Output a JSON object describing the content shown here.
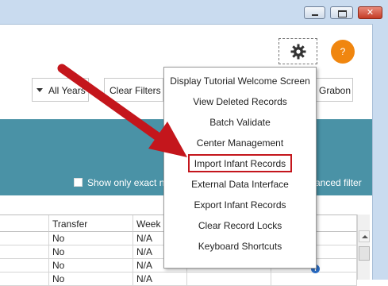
{
  "window": {
    "close_glyph": "✕",
    "buttons": [
      "minimize",
      "maximize",
      "close"
    ]
  },
  "header": {
    "settings_icon": "gear-icon",
    "help_label": "?",
    "help_color": "#f0860f"
  },
  "filters": {
    "years_selected": "All Years",
    "clear_filters_label": "Clear Filters",
    "partial_button_label": "Grabon"
  },
  "band": {
    "color": "#4a92a6",
    "exact_match_label": "Show only exact n",
    "advanced_filter_label": "anced filter"
  },
  "grid": {
    "columns": [
      "",
      "Transfer",
      "Week",
      "",
      ""
    ],
    "rows": [
      [
        "",
        "No",
        "N/A",
        "",
        ""
      ],
      [
        "",
        "No",
        "N/A",
        "",
        ""
      ],
      [
        "",
        "No",
        "N/A",
        "",
        ""
      ],
      [
        "",
        "No",
        "N/A",
        "",
        ""
      ]
    ],
    "info_glyph": "i"
  },
  "menu": {
    "items": [
      "Display Tutorial Welcome Screen",
      "View Deleted Records",
      "Batch Validate",
      "Center Management",
      "Import Infant Records",
      "External Data Interface",
      "Export Infant Records",
      "Clear Record Locks",
      "Keyboard Shortcuts"
    ],
    "highlighted_index": 4,
    "highlight_color": "#c4161c"
  },
  "annotation": {
    "arrow_color": "#c4161c"
  }
}
